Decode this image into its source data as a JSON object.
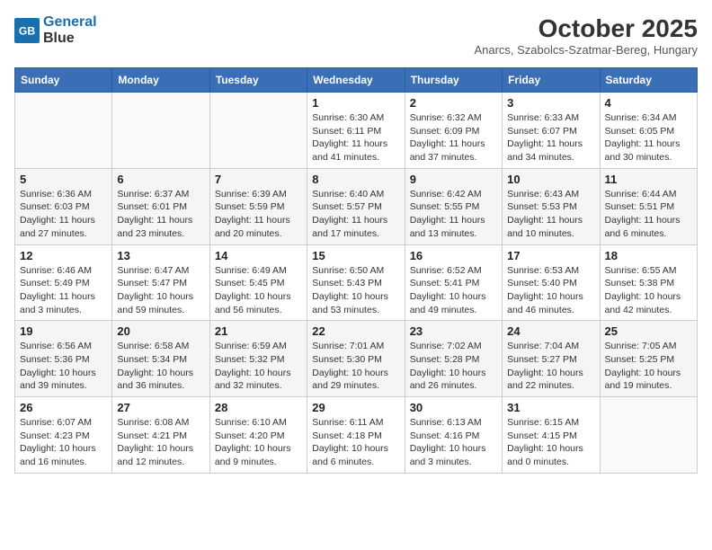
{
  "header": {
    "logo_line1": "General",
    "logo_line2": "Blue",
    "month": "October 2025",
    "location": "Anarcs, Szabolcs-Szatmar-Bereg, Hungary"
  },
  "weekdays": [
    "Sunday",
    "Monday",
    "Tuesday",
    "Wednesday",
    "Thursday",
    "Friday",
    "Saturday"
  ],
  "weeks": [
    [
      {
        "day": "",
        "info": ""
      },
      {
        "day": "",
        "info": ""
      },
      {
        "day": "",
        "info": ""
      },
      {
        "day": "1",
        "info": "Sunrise: 6:30 AM\nSunset: 6:11 PM\nDaylight: 11 hours\nand 41 minutes."
      },
      {
        "day": "2",
        "info": "Sunrise: 6:32 AM\nSunset: 6:09 PM\nDaylight: 11 hours\nand 37 minutes."
      },
      {
        "day": "3",
        "info": "Sunrise: 6:33 AM\nSunset: 6:07 PM\nDaylight: 11 hours\nand 34 minutes."
      },
      {
        "day": "4",
        "info": "Sunrise: 6:34 AM\nSunset: 6:05 PM\nDaylight: 11 hours\nand 30 minutes."
      }
    ],
    [
      {
        "day": "5",
        "info": "Sunrise: 6:36 AM\nSunset: 6:03 PM\nDaylight: 11 hours\nand 27 minutes."
      },
      {
        "day": "6",
        "info": "Sunrise: 6:37 AM\nSunset: 6:01 PM\nDaylight: 11 hours\nand 23 minutes."
      },
      {
        "day": "7",
        "info": "Sunrise: 6:39 AM\nSunset: 5:59 PM\nDaylight: 11 hours\nand 20 minutes."
      },
      {
        "day": "8",
        "info": "Sunrise: 6:40 AM\nSunset: 5:57 PM\nDaylight: 11 hours\nand 17 minutes."
      },
      {
        "day": "9",
        "info": "Sunrise: 6:42 AM\nSunset: 5:55 PM\nDaylight: 11 hours\nand 13 minutes."
      },
      {
        "day": "10",
        "info": "Sunrise: 6:43 AM\nSunset: 5:53 PM\nDaylight: 11 hours\nand 10 minutes."
      },
      {
        "day": "11",
        "info": "Sunrise: 6:44 AM\nSunset: 5:51 PM\nDaylight: 11 hours\nand 6 minutes."
      }
    ],
    [
      {
        "day": "12",
        "info": "Sunrise: 6:46 AM\nSunset: 5:49 PM\nDaylight: 11 hours\nand 3 minutes."
      },
      {
        "day": "13",
        "info": "Sunrise: 6:47 AM\nSunset: 5:47 PM\nDaylight: 10 hours\nand 59 minutes."
      },
      {
        "day": "14",
        "info": "Sunrise: 6:49 AM\nSunset: 5:45 PM\nDaylight: 10 hours\nand 56 minutes."
      },
      {
        "day": "15",
        "info": "Sunrise: 6:50 AM\nSunset: 5:43 PM\nDaylight: 10 hours\nand 53 minutes."
      },
      {
        "day": "16",
        "info": "Sunrise: 6:52 AM\nSunset: 5:41 PM\nDaylight: 10 hours\nand 49 minutes."
      },
      {
        "day": "17",
        "info": "Sunrise: 6:53 AM\nSunset: 5:40 PM\nDaylight: 10 hours\nand 46 minutes."
      },
      {
        "day": "18",
        "info": "Sunrise: 6:55 AM\nSunset: 5:38 PM\nDaylight: 10 hours\nand 42 minutes."
      }
    ],
    [
      {
        "day": "19",
        "info": "Sunrise: 6:56 AM\nSunset: 5:36 PM\nDaylight: 10 hours\nand 39 minutes."
      },
      {
        "day": "20",
        "info": "Sunrise: 6:58 AM\nSunset: 5:34 PM\nDaylight: 10 hours\nand 36 minutes."
      },
      {
        "day": "21",
        "info": "Sunrise: 6:59 AM\nSunset: 5:32 PM\nDaylight: 10 hours\nand 32 minutes."
      },
      {
        "day": "22",
        "info": "Sunrise: 7:01 AM\nSunset: 5:30 PM\nDaylight: 10 hours\nand 29 minutes."
      },
      {
        "day": "23",
        "info": "Sunrise: 7:02 AM\nSunset: 5:28 PM\nDaylight: 10 hours\nand 26 minutes."
      },
      {
        "day": "24",
        "info": "Sunrise: 7:04 AM\nSunset: 5:27 PM\nDaylight: 10 hours\nand 22 minutes."
      },
      {
        "day": "25",
        "info": "Sunrise: 7:05 AM\nSunset: 5:25 PM\nDaylight: 10 hours\nand 19 minutes."
      }
    ],
    [
      {
        "day": "26",
        "info": "Sunrise: 6:07 AM\nSunset: 4:23 PM\nDaylight: 10 hours\nand 16 minutes."
      },
      {
        "day": "27",
        "info": "Sunrise: 6:08 AM\nSunset: 4:21 PM\nDaylight: 10 hours\nand 12 minutes."
      },
      {
        "day": "28",
        "info": "Sunrise: 6:10 AM\nSunset: 4:20 PM\nDaylight: 10 hours\nand 9 minutes."
      },
      {
        "day": "29",
        "info": "Sunrise: 6:11 AM\nSunset: 4:18 PM\nDaylight: 10 hours\nand 6 minutes."
      },
      {
        "day": "30",
        "info": "Sunrise: 6:13 AM\nSunset: 4:16 PM\nDaylight: 10 hours\nand 3 minutes."
      },
      {
        "day": "31",
        "info": "Sunrise: 6:15 AM\nSunset: 4:15 PM\nDaylight: 10 hours\nand 0 minutes."
      },
      {
        "day": "",
        "info": ""
      }
    ]
  ]
}
